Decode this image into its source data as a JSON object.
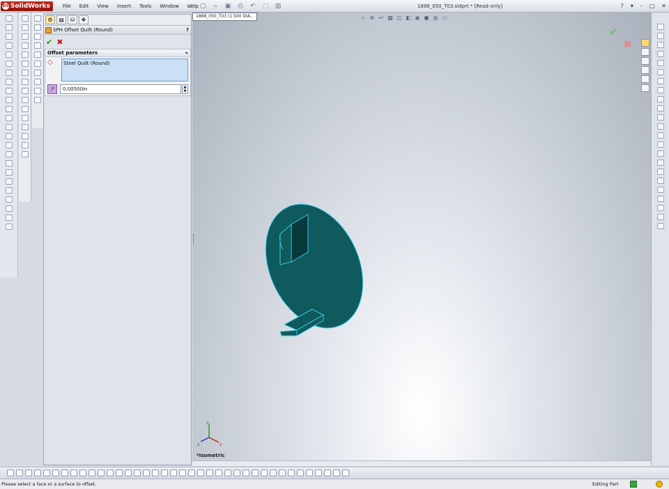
{
  "app": {
    "brand": "SolidWorks",
    "brand_mark": "DS",
    "menu": [
      "File",
      "Edit",
      "View",
      "Insert",
      "Tools",
      "Window",
      "Help"
    ],
    "document_title": "1888_050_T03.sldprt * [Read-only]",
    "window_controls": [
      "?",
      "▾",
      "-",
      "□",
      "✕"
    ]
  },
  "property_manager": {
    "feature_title": "SPH Offset Quilt (Round)",
    "help": "?",
    "group_title": "Offset parameters",
    "selection_value": "Steel Quilt (Round)",
    "distance_value": "0.00500in",
    "collapse_glyph": "«"
  },
  "viewport": {
    "document_tab": "1888_050_T03  (1.500 DIA...",
    "view_label": "*Isometric",
    "axes": [
      "x",
      "y",
      "z"
    ],
    "model_color": "#0e5a5c",
    "edge_color": "#39c7e8"
  },
  "statusbar": {
    "message": "Please select a face or a surface to offset.",
    "mode": "Editing Part"
  }
}
